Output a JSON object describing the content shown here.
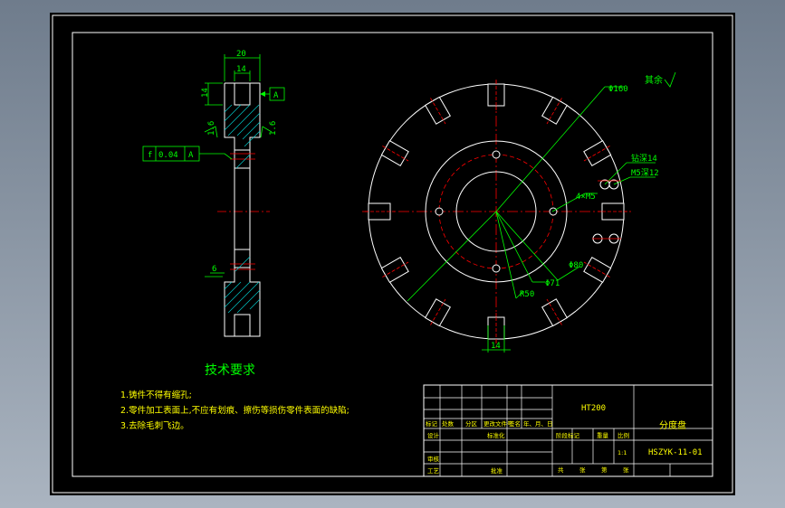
{
  "colors": {
    "background": "#000000",
    "frame": "#ffffff",
    "dimension": "#00ff00",
    "center_line": "#ff0000",
    "hatch": "#00c8c8",
    "notes": "#ffff00",
    "title_text": "#ffff00"
  },
  "dimensions": {
    "width_20": "20",
    "width_14": "14",
    "height_14": "14",
    "rough_left": "1.6",
    "rough_right": "1.6",
    "datum": "A",
    "tolerance_symbol": "f",
    "tolerance_value": "0.04",
    "tolerance_datum": "A",
    "depth_6": "6",
    "dia_160": "Φ160",
    "m_depth_14": "钻深14",
    "m5_depth_12": "M5深12",
    "holes_4xm5": "4×M5",
    "dia_80": "Φ80",
    "dia_71": "Φ71",
    "r50": "R50",
    "slot_width_14": "14",
    "surface_rest": "其余"
  },
  "notes": {
    "heading": "技术要求",
    "line1": "1.铸件不得有缩孔;",
    "line2": "2.零件加工表面上,不应有划痕、擦伤等损伤零件表面的缺陷;",
    "line3": "3.去除毛刺飞边。"
  },
  "title_block": {
    "material": "HT200",
    "part_name": "分度盘",
    "drawing_no": "HSZYK-11-01",
    "scale": "1:1",
    "row_labels": [
      "标记",
      "处数",
      "分区",
      "更改文件号",
      "签名",
      "年、月、日"
    ],
    "designer": "设计",
    "standardization": "标准化",
    "review": "审核",
    "process": "工艺",
    "approve": "批准",
    "stage_mark": "阶段标记",
    "weight": "重量",
    "scale_label": "比例",
    "sheet_total": "共",
    "sheet_of": "张",
    "sheet_no": "第",
    "sheet_no2": "张"
  }
}
